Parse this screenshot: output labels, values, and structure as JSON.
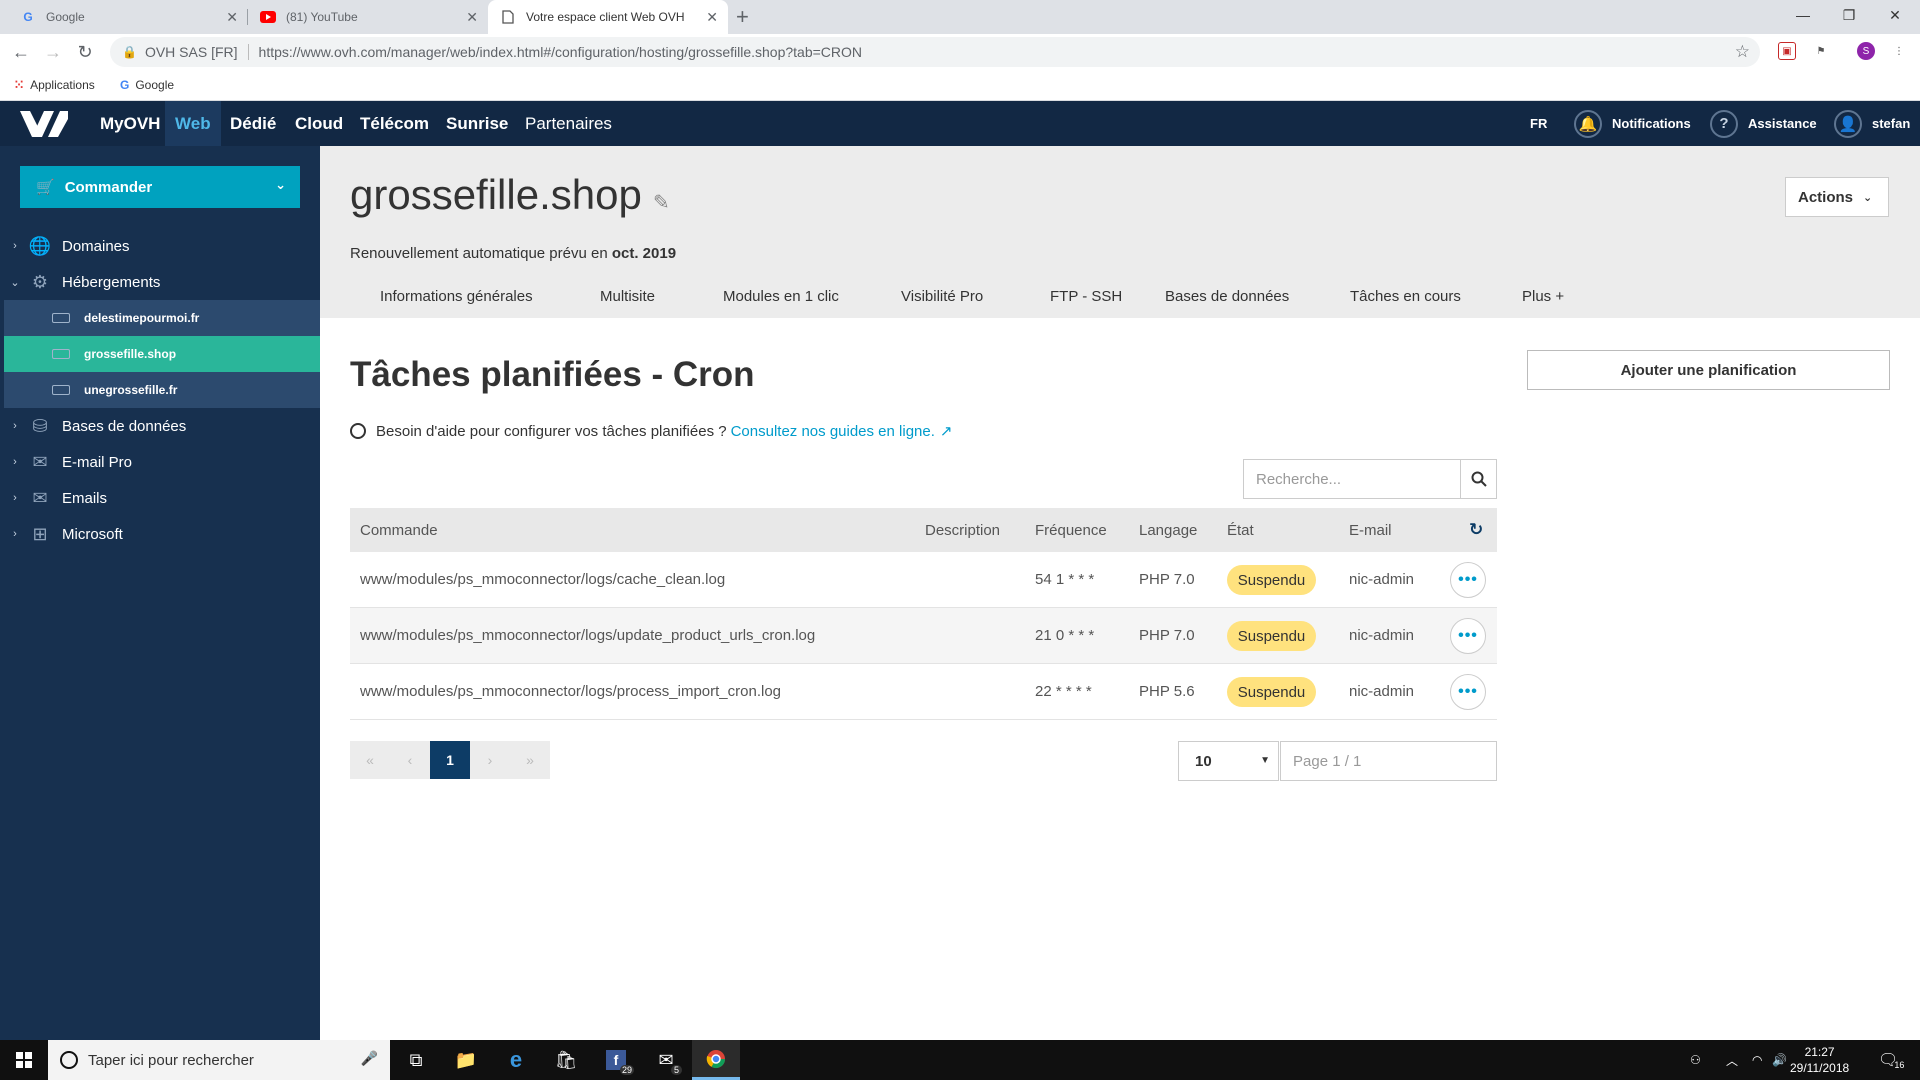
{
  "browser": {
    "tabs": [
      {
        "title": "Google",
        "favicon": "G"
      },
      {
        "title": "(81) YouTube",
        "favicon": "youtube-icon"
      },
      {
        "title": "Votre espace client Web OVH",
        "favicon": "page-icon"
      }
    ],
    "org": "OVH SAS [FR]",
    "url": "https://www.ovh.com/manager/web/index.html#/configuration/hosting/grossefille.shop?tab=CRON",
    "bookmarks": [
      "Applications",
      "Google"
    ]
  },
  "header": {
    "nav": [
      "MyOVH",
      "Web",
      "Dédié",
      "Cloud",
      "Télécom",
      "Sunrise",
      "Partenaires"
    ],
    "lang": "FR",
    "notifications": "Notifications",
    "assistance": "Assistance",
    "user": "stefan"
  },
  "sidebar": {
    "order_label": "Commander",
    "items": [
      {
        "label": "Domaines",
        "icon": "globe-icon"
      },
      {
        "label": "Hébergements",
        "icon": "hosting-icon"
      },
      {
        "label": "Bases de données",
        "icon": "database-icon"
      },
      {
        "label": "E-mail Pro",
        "icon": "mail-icon"
      },
      {
        "label": "Emails",
        "icon": "mail-icon"
      },
      {
        "label": "Microsoft",
        "icon": "windows-icon"
      }
    ],
    "sub_items": [
      "delestimepourmoi.fr",
      "grossefille.shop",
      "unegrossefille.fr"
    ]
  },
  "page": {
    "site": "grossefille.shop",
    "renewal_prefix": "Renouvellement automatique prévu en",
    "renewal_date": "oct. 2019",
    "actions": "Actions",
    "tabs": [
      "Informations générales",
      "Multisite",
      "Modules en 1 clic",
      "Visibilité Pro",
      "FTP - SSH",
      "Bases de données",
      "Tâches en cours",
      "Plus +"
    ],
    "title": "Tâches planifiées - Cron",
    "add_button": "Ajouter une planification",
    "help_text": "Besoin d'aide pour configurer vos tâches planifiées ?",
    "help_link": "Consultez nos guides en ligne.",
    "search_placeholder": "Recherche..."
  },
  "table": {
    "headers": [
      "Commande",
      "Description",
      "Fréquence",
      "Langage",
      "État",
      "E-mail"
    ],
    "rows": [
      {
        "command": "www/modules/ps_mmoconnector/logs/cache_clean.log",
        "description": "",
        "frequency": "54 1 * * *",
        "language": "PHP 7.0",
        "state": "Suspendu",
        "email": "nic-admin"
      },
      {
        "command": "www/modules/ps_mmoconnector/logs/update_product_urls_cron.log",
        "description": "",
        "frequency": "21 0 * * *",
        "language": "PHP 7.0",
        "state": "Suspendu",
        "email": "nic-admin"
      },
      {
        "command": "www/modules/ps_mmoconnector/logs/process_import_cron.log",
        "description": "",
        "frequency": "22 * * * *",
        "language": "PHP 5.6",
        "state": "Suspendu",
        "email": "nic-admin"
      }
    ]
  },
  "pagination": {
    "first": "«",
    "prev": "‹",
    "current": "1",
    "next": "›",
    "last": "»",
    "per_page": "10",
    "page_label": "Page 1 / 1"
  },
  "taskbar": {
    "search_placeholder": "Taper ici pour rechercher",
    "time": "21:27",
    "date": "29/11/2018",
    "badge_fb": "29",
    "badge_mail": "5",
    "badge_notif": "16"
  },
  "colors": {
    "ovh_navy": "#122844",
    "sidebar": "#17304f",
    "accent": "#00a2bf",
    "active_sub": "#2ab69a",
    "badge_suspended": "#ffe27e",
    "link": "#009bcb"
  }
}
